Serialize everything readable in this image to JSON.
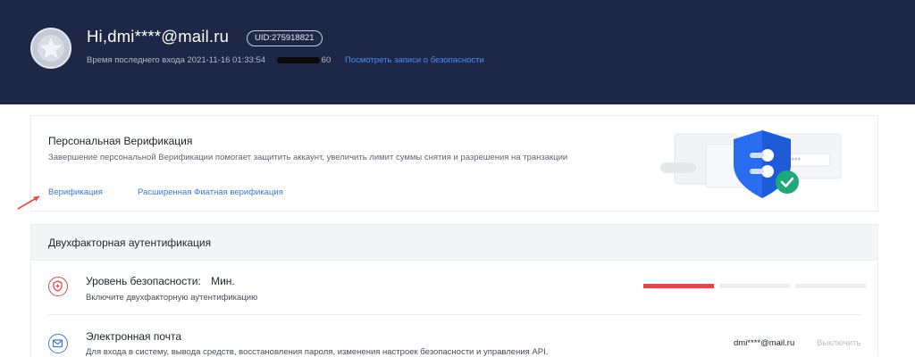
{
  "header": {
    "greeting": "Hi,dmi****@mail.ru",
    "uid": "UID:275918821",
    "last_login_label": "Время последнего входа",
    "last_login_time": "2021-11-16 01:33:54",
    "last_login_ip_tail": "60",
    "security_records_link": "Посмотреть записи о безопасности"
  },
  "verification": {
    "title": "Персональная Верификация",
    "description": "Завершение персональной Верификации помогает защитить аккаунт, увеличить лимит суммы снятия и разрешения на транзакции",
    "link_basic": "Верификация",
    "link_advanced": "Расширенная Фиатная верификация"
  },
  "two_factor": {
    "title": "Двухфакторная аутентификация",
    "security_level_label": "Уровень безопасности:",
    "security_level_value": "Мин.",
    "security_level_hint": "Включите двухфакторную аутентификацию",
    "security_level_fraction": 0.333,
    "email_title": "Электронная почта",
    "email_desc": "Для входа в систему, вывода средств, восстановления пароля, изменения настроек безопасности и управления API.",
    "email_value": "dmi****@mail.ru",
    "email_disable": "Выключить"
  },
  "colors": {
    "header_bg": "#1e2745",
    "accent_link": "#3c78d8",
    "danger": "#e04a4a",
    "success": "#1fa97a"
  },
  "icons": [
    "avatar-star-icon",
    "shield-check-illustration",
    "shield-warning-icon",
    "mail-icon",
    "red-arrow"
  ]
}
